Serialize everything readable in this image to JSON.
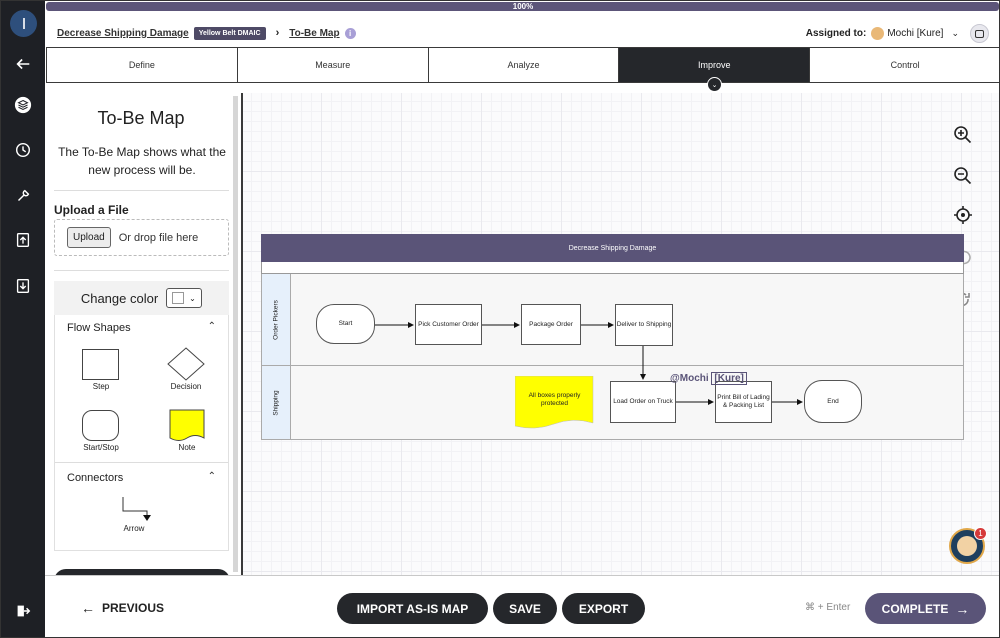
{
  "progress": {
    "label": "100%",
    "value": 1.0
  },
  "breadcrumb": {
    "project": "Decrease Shipping Damage",
    "badge": "Yellow Belt DMAIC",
    "separator": "›",
    "current": "To-Be Map",
    "info_icon": "info-icon"
  },
  "assigned": {
    "label": "Assigned to:",
    "name": "Mochi [Kure]"
  },
  "tabs": [
    {
      "label": "Define"
    },
    {
      "label": "Measure"
    },
    {
      "label": "Analyze"
    },
    {
      "label": "Improve",
      "active": true
    },
    {
      "label": "Control"
    }
  ],
  "rail_icons": [
    "layers-icon",
    "clock-icon",
    "wrench-icon",
    "upload-icon",
    "download-icon",
    "logout-icon"
  ],
  "panel": {
    "title": "To-Be Map",
    "description": "The To-Be Map shows what the new process will be.",
    "upload_heading": "Upload a File",
    "upload_button": "Upload",
    "drop_text": "Or drop file here",
    "change_color": "Change color",
    "flow_shapes_title": "Flow Shapes",
    "shapes": [
      "Step",
      "Decision",
      "Start/Stop",
      "Note"
    ],
    "connectors_title": "Connectors",
    "connectors": [
      "Arrow"
    ]
  },
  "canvas_tools": [
    "zoom-in-icon",
    "zoom-out-icon",
    "recenter-icon",
    "undo-icon",
    "redo-icon"
  ],
  "diagram": {
    "title": "Decrease Shipping Damage",
    "lanes": [
      "Order Pickers",
      "Shipping"
    ],
    "nodes": {
      "start": "Start",
      "pick": "Pick Customer Order",
      "package": "Package Order",
      "deliver": "Deliver to Shipping",
      "load": "Load Order on Truck",
      "print": "Print Bill of Lading & Packing List",
      "end": "End",
      "note": "All boxes properly protected"
    },
    "cursor_user": "@Mochi",
    "cursor_tag": "[Kure]"
  },
  "help": {
    "badge": "1"
  },
  "footer": {
    "previous": "PREVIOUS",
    "import": "IMPORT AS-IS MAP",
    "save": "SAVE",
    "export": "EXPORT",
    "shortcut": "⌘ + Enter",
    "complete": "COMPLETE"
  },
  "colors": {
    "accent": "#5a5478",
    "dark": "#25272b",
    "note": "#ffff00",
    "lane_label": "#e6f0fb"
  }
}
